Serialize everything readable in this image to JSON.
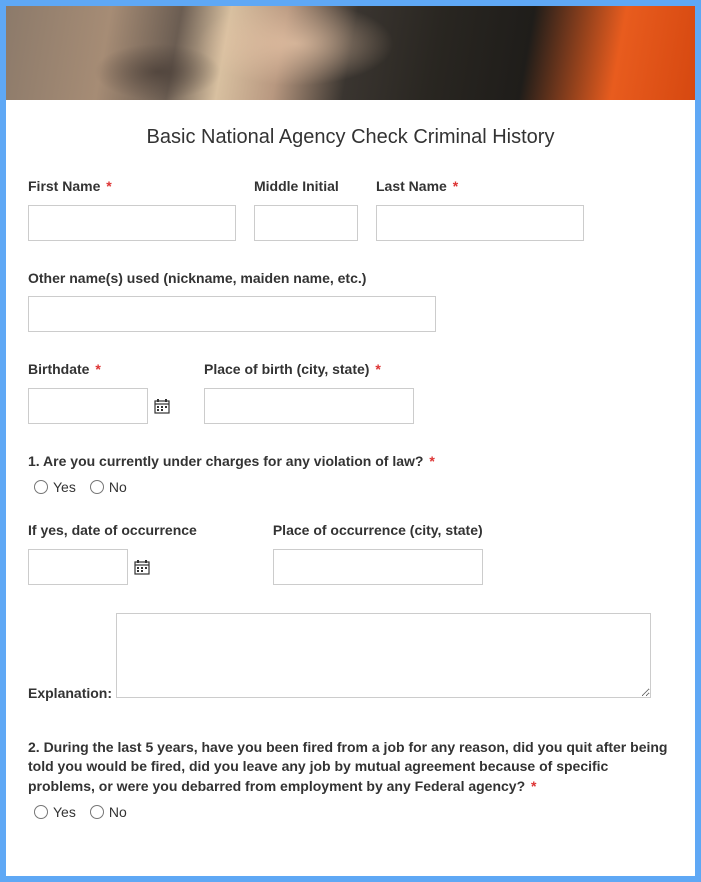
{
  "title": "Basic National Agency Check Criminal History",
  "fields": {
    "first_name": {
      "label": "First Name",
      "required": true
    },
    "middle_initial": {
      "label": "Middle Initial",
      "required": false
    },
    "last_name": {
      "label": "Last Name",
      "required": true
    },
    "other_names": {
      "label": "Other name(s) used (nickname, maiden name, etc.)",
      "required": false
    },
    "birthdate": {
      "label": "Birthdate",
      "required": true
    },
    "place_of_birth": {
      "label": "Place of birth (city, state)",
      "required": true
    },
    "q1": {
      "label": "1. Are you currently under charges for any violation of law?",
      "required": true
    },
    "date_occurrence": {
      "label": "If yes, date of occurrence",
      "required": false
    },
    "place_occurrence": {
      "label": "Place of occurrence (city, state)",
      "required": false
    },
    "explanation": {
      "label": "Explanation:",
      "required": false
    },
    "q2": {
      "label": "2. During the last 5 years, have you been fired from a job for any reason, did you quit after being told you would be fired, did you leave any job by mutual agreement because of specific problems, or were you debarred from employment by any Federal agency?",
      "required": true
    }
  },
  "options": {
    "yes": "Yes",
    "no": "No"
  },
  "required_marker": "*"
}
